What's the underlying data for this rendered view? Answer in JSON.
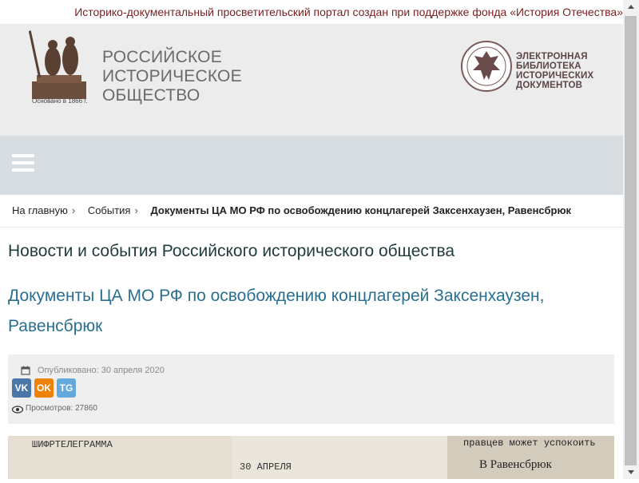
{
  "topbar": {
    "text": "Историко-документальный просветительский портал создан при поддержке фонда «История Отечества»"
  },
  "header": {
    "rio_lines": [
      "РОССИЙСКОЕ",
      "ИСТОРИЧЕСКОЕ",
      "ОБЩЕСТВО"
    ],
    "rio_founded": "Основано в 1866 г.",
    "elib_lines": [
      "ЭЛЕКТРОННАЯ",
      "БИБЛИОТЕКА",
      "ИСТОРИЧЕСКИХ",
      "ДОКУМЕНТОВ"
    ]
  },
  "breadcrumb": {
    "home": "На главную",
    "events": "События",
    "current": "Документы ЦА МО РФ по освобождению концлагерей Заксенхаузен, Равенсбрюк"
  },
  "section_title": "Новости и события Российского исторического общества",
  "article": {
    "title": "Документы ЦА МО РФ по освобождению концлагерей Заксенхаузен, Равенсбрюк",
    "published": "Опубликовано: 30 апреля 2020",
    "views": "Просмотров: 27860"
  },
  "share": {
    "vk": "VK",
    "ok": "OK",
    "tg": "TG"
  },
  "photo": {
    "text_left_1": "ШИФРТЕЛЕГРАММА",
    "text_left_2": "30 АПРЕЛЯ",
    "text_right_1": "правцев может успокоить",
    "text_right_2": "В Равенсбрюк"
  },
  "colors": {
    "topbar_text": "#7a1f1f",
    "link": "#2a6f8f",
    "nav": "#d8dde2",
    "header_bg": "#ececec"
  }
}
